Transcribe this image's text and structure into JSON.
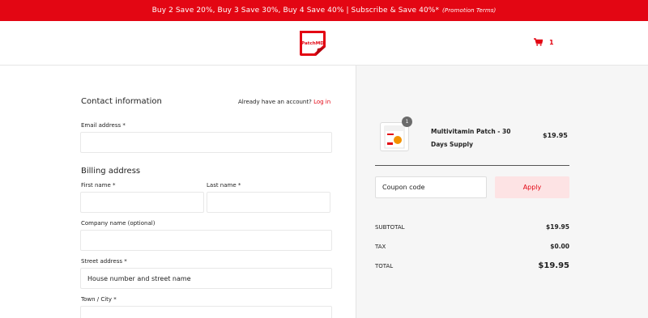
{
  "promo": {
    "text": "Buy 2 Save 20%, Buy 3 Save 30%, Buy 4 Save 40% | Subscribe & Save 40%*",
    "terms": "(Promotion Terms)"
  },
  "header": {
    "logo_text": "PatchMD",
    "cart_count": "1"
  },
  "contact": {
    "title": "Contact information",
    "account_prompt": "Already have an account?",
    "login_link": "Log in",
    "email_label": "Email address *",
    "email_value": ""
  },
  "billing": {
    "title": "Billing address",
    "first_name_label": "First name *",
    "last_name_label": "Last name *",
    "company_label": "Company name (optional)",
    "street_label": "Street address *",
    "street_placeholder": "House number and street name",
    "city_label": "Town / City *"
  },
  "order": {
    "item": {
      "name": "Multivitamin Patch - 30 Days Supply",
      "price": "$19.95",
      "quantity": "1"
    },
    "coupon_placeholder": "Coupon code",
    "apply_label": "Apply",
    "summary": [
      {
        "label": "SUBTOTAL",
        "value": "$19.95"
      },
      {
        "label": "TAX",
        "value": "$0.00"
      },
      {
        "label": "TOTAL",
        "value": "$19.95"
      }
    ]
  },
  "colors": {
    "brand_red": "#e30613",
    "apply_bg": "#fde3e4",
    "panel_bg": "#f6f6f6"
  }
}
